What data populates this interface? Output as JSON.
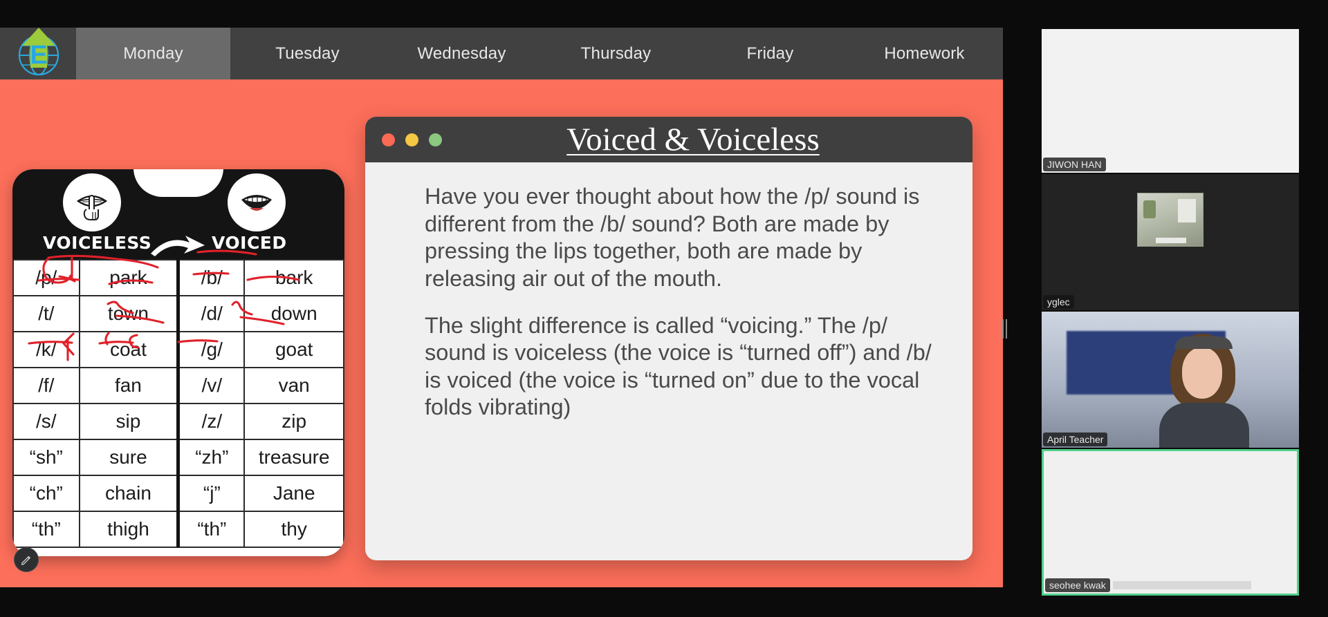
{
  "app": {
    "background_color": "#0b0b0b",
    "accent_color": "#fc6f5a"
  },
  "tabs": {
    "logo_name": "eduglobe-logo",
    "items": [
      {
        "label": "Monday",
        "active": true
      },
      {
        "label": "Tuesday",
        "active": false
      },
      {
        "label": "Wednesday",
        "active": false
      },
      {
        "label": "Thursday",
        "active": false
      },
      {
        "label": "Friday",
        "active": false
      },
      {
        "label": "Homework",
        "active": false
      }
    ]
  },
  "slide": {
    "title": "Voiced & Voiceless",
    "window_dots": [
      "close-red",
      "minimize-yellow",
      "maximize-green"
    ],
    "paragraphs": [
      "Have you ever thought about how the /p/ sound is different from the /b/ sound? Both are made by pressing the lips together, both are made by releasing air out of the mouth.",
      "The slight difference is called “voicing.” The /p/ sound is voiceless (the voice is “turned off”) and /b/ is voiced (the voice is “turned on” due to the vocal folds vibrating)"
    ]
  },
  "chart": {
    "header_left": "VOICELESS",
    "header_right": "VOICED",
    "left_icon": "shush-mouth-icon",
    "right_icon": "open-mouth-icon",
    "arrow_icon": "curved-arrow-icon",
    "rows": [
      {
        "voiceless_ipa": "/p/",
        "voiceless_word": "park",
        "voiced_ipa": "/b/",
        "voiced_word": "bark"
      },
      {
        "voiceless_ipa": "/t/",
        "voiceless_word": "town",
        "voiced_ipa": "/d/",
        "voiced_word": "down"
      },
      {
        "voiceless_ipa": "/k/",
        "voiceless_word": "coat",
        "voiced_ipa": "/g/",
        "voiced_word": "goat"
      },
      {
        "voiceless_ipa": "/f/",
        "voiceless_word": "fan",
        "voiced_ipa": "/v/",
        "voiced_word": "van"
      },
      {
        "voiceless_ipa": "/s/",
        "voiceless_word": "sip",
        "voiced_ipa": "/z/",
        "voiced_word": "zip"
      },
      {
        "voiceless_ipa": "“sh”",
        "voiceless_word": "sure",
        "voiced_ipa": "“zh”",
        "voiced_word": "treasure"
      },
      {
        "voiceless_ipa": "“ch”",
        "voiceless_word": "chain",
        "voiced_ipa": "“j”",
        "voiced_word": "Jane"
      },
      {
        "voiceless_ipa": "“th”",
        "voiceless_word": "thigh",
        "voiced_ipa": "“th”",
        "voiced_word": "thy"
      }
    ],
    "annotation_color": "#e0212a",
    "annotations": "red handwritten marks over /p/, park, /b/, bark, town, down, /k/ K, coat c, /g/"
  },
  "toolbar": {
    "pen_button_name": "annotate-pen-button",
    "pen_icon": "pencil-icon"
  },
  "gallery": {
    "participants": [
      {
        "name": "JIWON HAN",
        "video": "blank-white",
        "speaking": false
      },
      {
        "name": "yglec",
        "video": "room-thumbnail",
        "speaking": false
      },
      {
        "name": "April Teacher",
        "video": "webcam-person",
        "speaking": false
      },
      {
        "name": "seohee kwak",
        "video": "blank-white",
        "speaking": true
      }
    ],
    "active_border_color": "#4fd18b"
  }
}
